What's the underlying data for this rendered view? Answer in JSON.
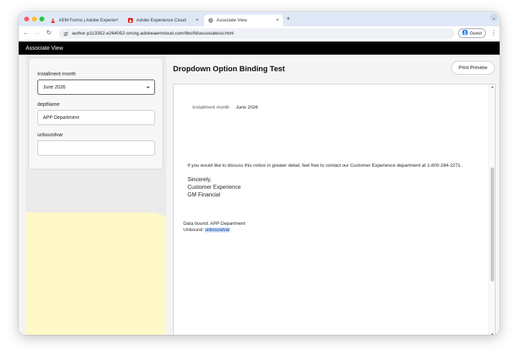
{
  "browser": {
    "tabs": [
      {
        "title": "AEM Forms | Adobe Experien",
        "icon": "adobe-a-icon"
      },
      {
        "title": "Adobe Experience Cloud",
        "icon": "adobe-red-icon"
      },
      {
        "title": "Associate View",
        "icon": "globe-icon"
      }
    ],
    "new_tab_label": "+",
    "tab_close_label": "×",
    "url": "author-p113352-e264052-cmstg.adobeaemcloud.com/libs/fd/associate/ui.html",
    "profile_label": "Guest",
    "menu_label": "⋮",
    "tab_list_label": "⌄"
  },
  "app": {
    "title": "Associate View"
  },
  "form": {
    "fields": [
      {
        "label": "Installment month",
        "value": "June 2026",
        "type": "select"
      },
      {
        "label": "deptName",
        "value": "APP Department",
        "type": "text"
      },
      {
        "label": "unboundvar",
        "value": "",
        "type": "text"
      }
    ]
  },
  "document": {
    "title": "Dropdown Option Binding Test",
    "print_label": "Print Preview",
    "preview": {
      "installment_label": "Installment month",
      "installment_value": "June 2026",
      "notice_line": "If you would like to discuss this notice in greater detail, feel free to contact our Customer Experience department at 1-800-284-2271.",
      "signoff": "Sincerely,",
      "signature_line1": "Customer Experience",
      "signature_line2": "GM Financial",
      "data_bound": "Data bound: APP Department",
      "unbound_label": "Unbound:",
      "unbound_value": "unboundvar"
    }
  },
  "colors": {
    "app_bar": "#000000",
    "tab_strip": "#dfe8f7",
    "left_panel": "#ebebeb",
    "yellow_blob": "#fff8c8",
    "highlight": "#c9dcf6"
  }
}
